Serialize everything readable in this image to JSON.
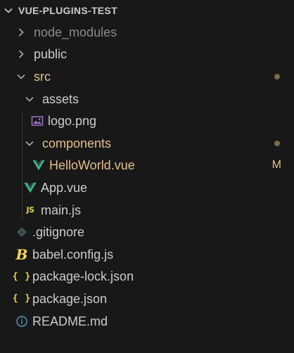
{
  "explorer": {
    "title": "VUE-PLUGINS-TEST",
    "items": [
      {
        "label": "node_modules",
        "icon": "chevron-right-icon"
      },
      {
        "label": "public",
        "icon": "chevron-right-icon"
      },
      {
        "label": "src",
        "icon": "chevron-down-icon"
      },
      {
        "label": "assets",
        "icon": "chevron-down-icon"
      },
      {
        "label": "logo.png",
        "icon": "image-file-icon"
      },
      {
        "label": "components",
        "icon": "chevron-down-icon"
      },
      {
        "label": "HelloWorld.vue",
        "icon": "vue-file-icon",
        "badge": "M"
      },
      {
        "label": "App.vue",
        "icon": "vue-file-icon"
      },
      {
        "label": "main.js",
        "icon": "js-file-icon",
        "icon_text": "JS"
      },
      {
        "label": ".gitignore",
        "icon": "git-file-icon"
      },
      {
        "label": "babel.config.js",
        "icon": "babel-file-icon",
        "icon_text": "B"
      },
      {
        "label": "package-lock.json",
        "icon": "json-file-icon",
        "icon_text": "{ }"
      },
      {
        "label": "package.json",
        "icon": "json-file-icon",
        "icon_text": "{ }"
      },
      {
        "label": "README.md",
        "icon": "info-file-icon"
      }
    ]
  },
  "colors": {
    "background": "#181818",
    "text": "#cccccc",
    "dimmed": "#8b8b8b",
    "modified": "#e2c08d",
    "vue": "#41b883",
    "js": "#e8d44d"
  }
}
